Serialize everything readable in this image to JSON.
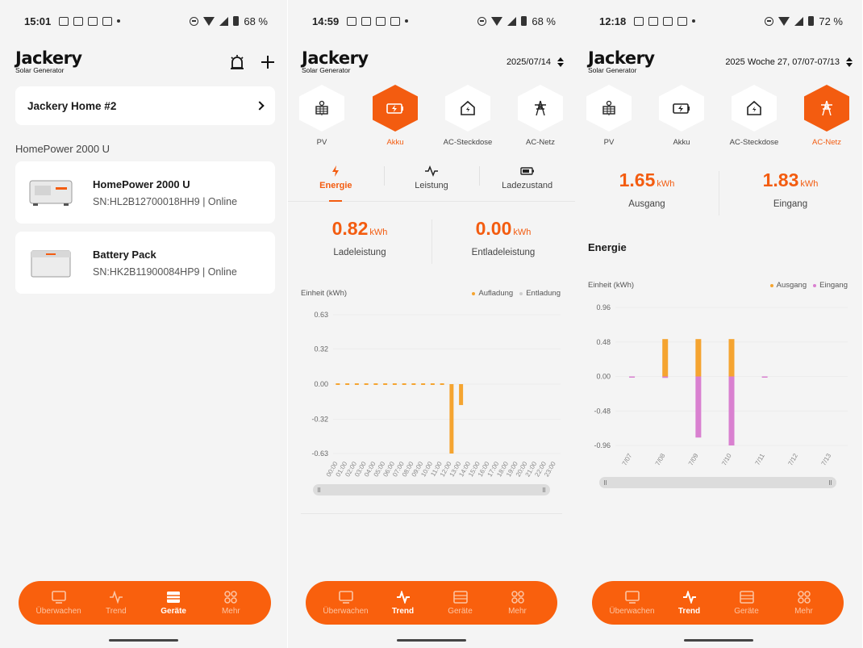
{
  "screens": [
    {
      "status": {
        "time": "15:01",
        "battery": "68 %"
      },
      "home_name": "Jackery Home #2",
      "section": "HomePower 2000 U",
      "devices": [
        {
          "name": "HomePower 2000 U",
          "sn": "SN:HL2B12700018HH9 | Online"
        },
        {
          "name": "Battery Pack",
          "sn": "SN:HK2B11900084HP9 | Online"
        }
      ],
      "nav_active": "Geräte"
    },
    {
      "status": {
        "time": "14:59",
        "battery": "68 %"
      },
      "date": "2025/07/14",
      "active_hex": "Akku",
      "subtabs": [
        "Energie",
        "Leistung",
        "Ladezustand"
      ],
      "stats": [
        {
          "value": "0.82",
          "unit": "kWh",
          "label": "Ladeleistung"
        },
        {
          "value": "0.00",
          "unit": "kWh",
          "label": "Entladeleistung"
        }
      ],
      "legend": {
        "unit_label": "Einheit (kWh)",
        "series": [
          "Aufladung",
          "Entladung"
        ]
      },
      "nav_active": "Trend"
    },
    {
      "status": {
        "time": "12:18",
        "battery": "72 %"
      },
      "date": "2025 Woche 27, 07/07-07/13",
      "active_hex": "AC-Netz",
      "stats": [
        {
          "value": "1.65",
          "unit": "kWh",
          "label": "Ausgang"
        },
        {
          "value": "1.83",
          "unit": "kWh",
          "label": "Eingang"
        }
      ],
      "section": "Energie",
      "legend": {
        "unit_label": "Einheit (kWh)",
        "series": [
          "Ausgang",
          "Eingang"
        ]
      },
      "nav_active": "Trend"
    }
  ],
  "brand": {
    "name": "Jackery",
    "sub": "Solar Generator"
  },
  "hex_items": [
    "PV",
    "Akku",
    "AC-Steckdose",
    "AC-Netz"
  ],
  "nav_items": [
    "Überwachen",
    "Trend",
    "Geräte",
    "Mehr"
  ],
  "colors": {
    "accent": "#f35c10",
    "nav_bg": "#f9600d",
    "series_orange": "#f5a430",
    "series_pink": "#d980d0"
  },
  "chart_data": [
    {
      "type": "bar",
      "ylabel": "Einheit (kWh)",
      "ylim": [
        -0.63,
        0.63
      ],
      "yticks": [
        "0.63",
        "0.32",
        "0.00",
        "-0.32",
        "-0.63"
      ],
      "categories": [
        "00:00",
        "01:00",
        "02:00",
        "03:00",
        "04:00",
        "05:00",
        "06:00",
        "07:00",
        "08:00",
        "09:00",
        "10:00",
        "11:00",
        "12:00",
        "13:00",
        "14:00",
        "15:00",
        "16:00",
        "17:00",
        "18:00",
        "19:00",
        "20:00",
        "21:00",
        "22:00",
        "23:00"
      ],
      "series": [
        {
          "name": "Aufladung",
          "values": [
            0,
            0,
            0,
            0,
            0,
            0,
            0,
            0,
            0,
            0,
            0,
            0,
            -0.63,
            -0.19,
            null,
            null,
            null,
            null,
            null,
            null,
            null,
            null,
            null,
            null
          ]
        },
        {
          "name": "Entladung",
          "values": [
            0,
            0,
            0,
            0,
            0,
            0,
            0,
            0,
            0,
            0,
            0,
            0,
            0,
            0,
            null,
            null,
            null,
            null,
            null,
            null,
            null,
            null,
            null,
            null
          ]
        }
      ],
      "grid": true,
      "legend_position": "top-right"
    },
    {
      "type": "bar",
      "ylabel": "Einheit (kWh)",
      "ylim": [
        -0.96,
        0.96
      ],
      "yticks": [
        "0.96",
        "0.48",
        "0.00",
        "-0.48",
        "-0.96"
      ],
      "categories": [
        "7/07",
        "7/08",
        "7/09",
        "7/10",
        "7/11",
        "7/12",
        "7/13"
      ],
      "series": [
        {
          "name": "Ausgang",
          "values": [
            0.0,
            0.52,
            0.52,
            0.52,
            0.0,
            0.0,
            0.0
          ]
        },
        {
          "name": "Eingang",
          "values": [
            -0.01,
            -0.02,
            -0.85,
            -0.96,
            -0.01,
            0.0,
            0.0
          ]
        }
      ],
      "grid": true,
      "legend_position": "top-right"
    }
  ]
}
